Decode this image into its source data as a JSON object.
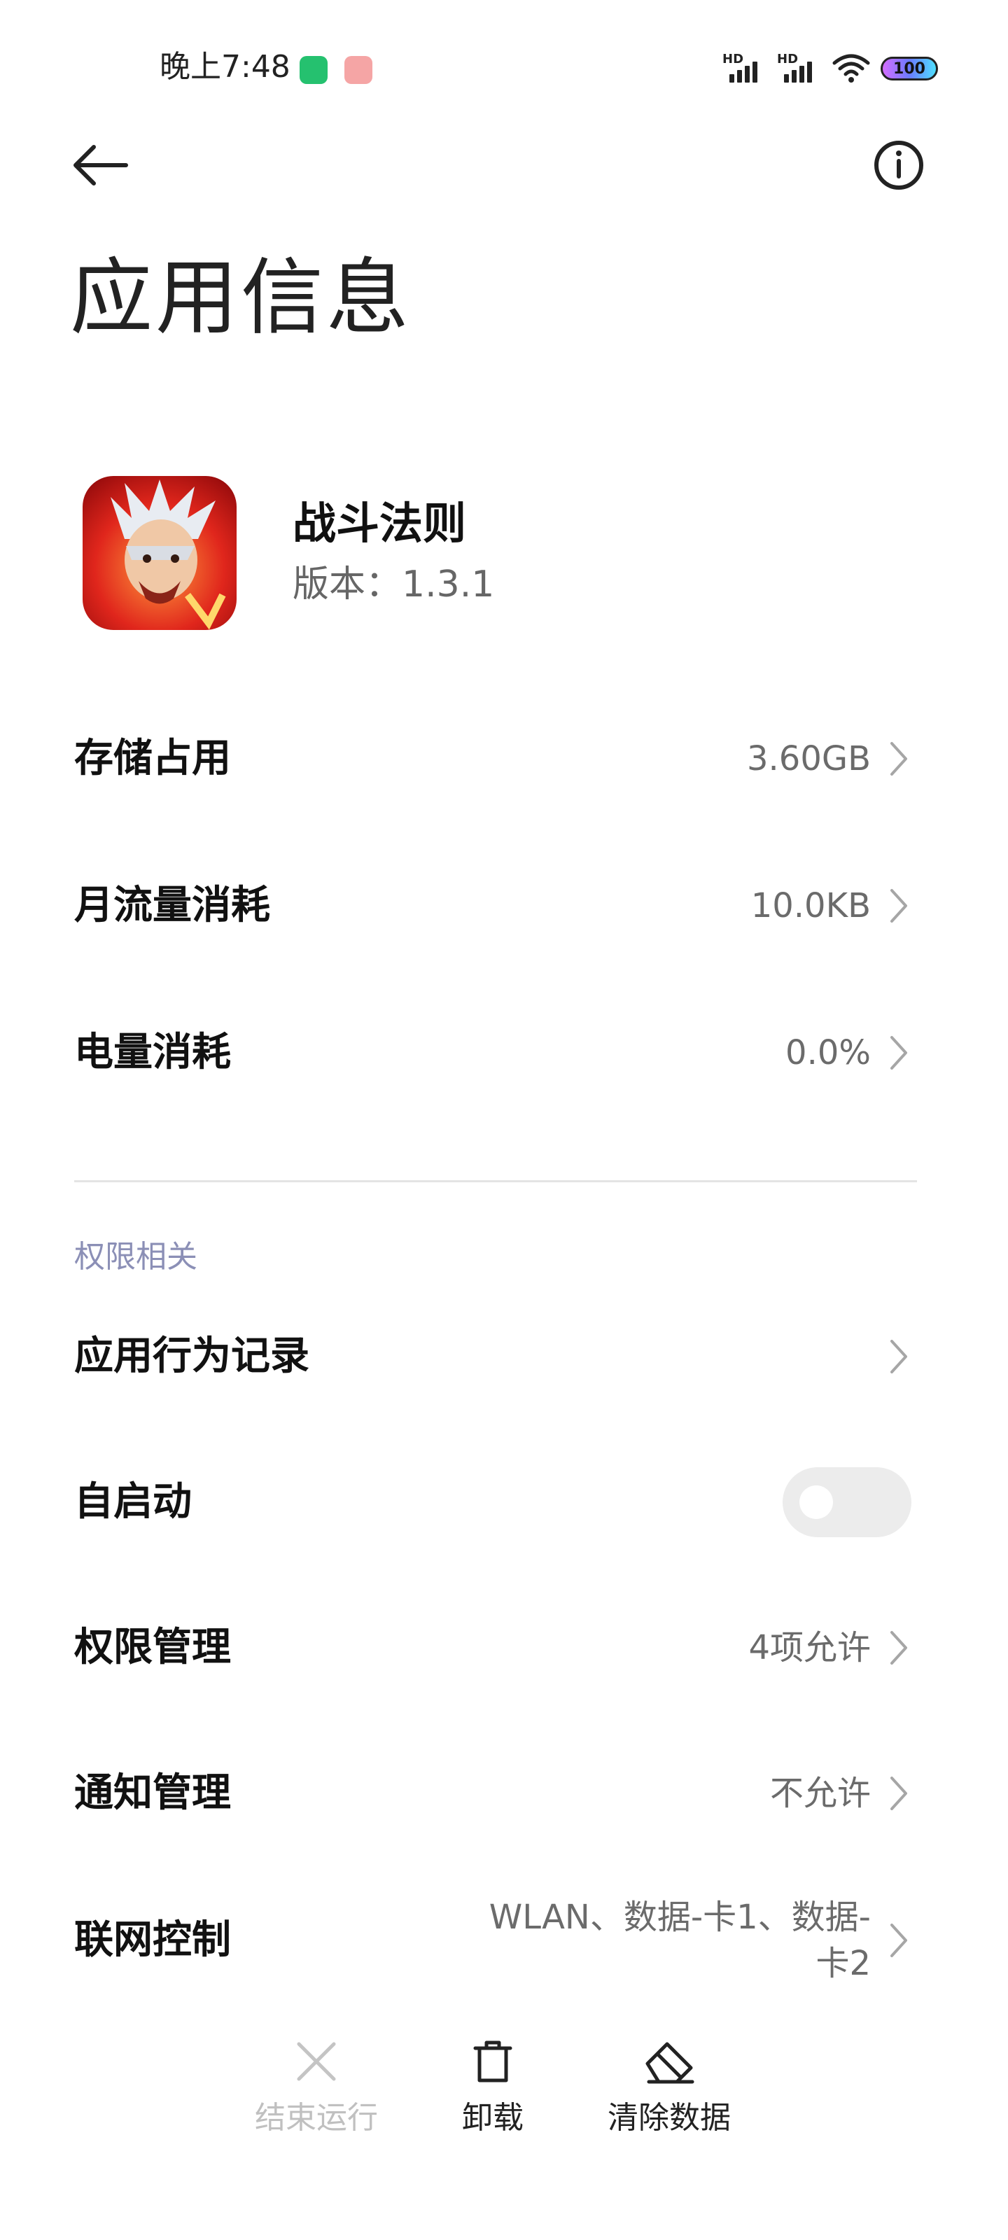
{
  "status_bar": {
    "time": "晚上7:48",
    "network_label": "HD",
    "battery": "100"
  },
  "header": {
    "title": "应用信息"
  },
  "app": {
    "name": "战斗法则",
    "version": "版本：1.3.1"
  },
  "usage": {
    "storage": {
      "label": "存储占用",
      "value": "3.60GB"
    },
    "data": {
      "label": "月流量消耗",
      "value": "10.0KB"
    },
    "battery": {
      "label": "电量消耗",
      "value": "0.0%"
    }
  },
  "permissions": {
    "section_title": "权限相关",
    "behavior_log": {
      "label": "应用行为记录"
    },
    "autostart": {
      "label": "自启动",
      "enabled": false
    },
    "permission_mgmt": {
      "label": "权限管理",
      "value": "4项允许"
    },
    "notification_mgmt": {
      "label": "通知管理",
      "value": "不允许"
    },
    "network_control": {
      "label": "联网控制",
      "value": "WLAN、数据-卡1、数据-卡2"
    }
  },
  "actions": {
    "stop": {
      "label": "结束运行",
      "enabled": false
    },
    "uninstall": {
      "label": "卸载"
    },
    "clear_data": {
      "label": "清除数据"
    }
  },
  "colors": {
    "section_header": "#8b8fb6",
    "value_gray": "#6b6b6b",
    "toggle_off": "#ececec"
  }
}
